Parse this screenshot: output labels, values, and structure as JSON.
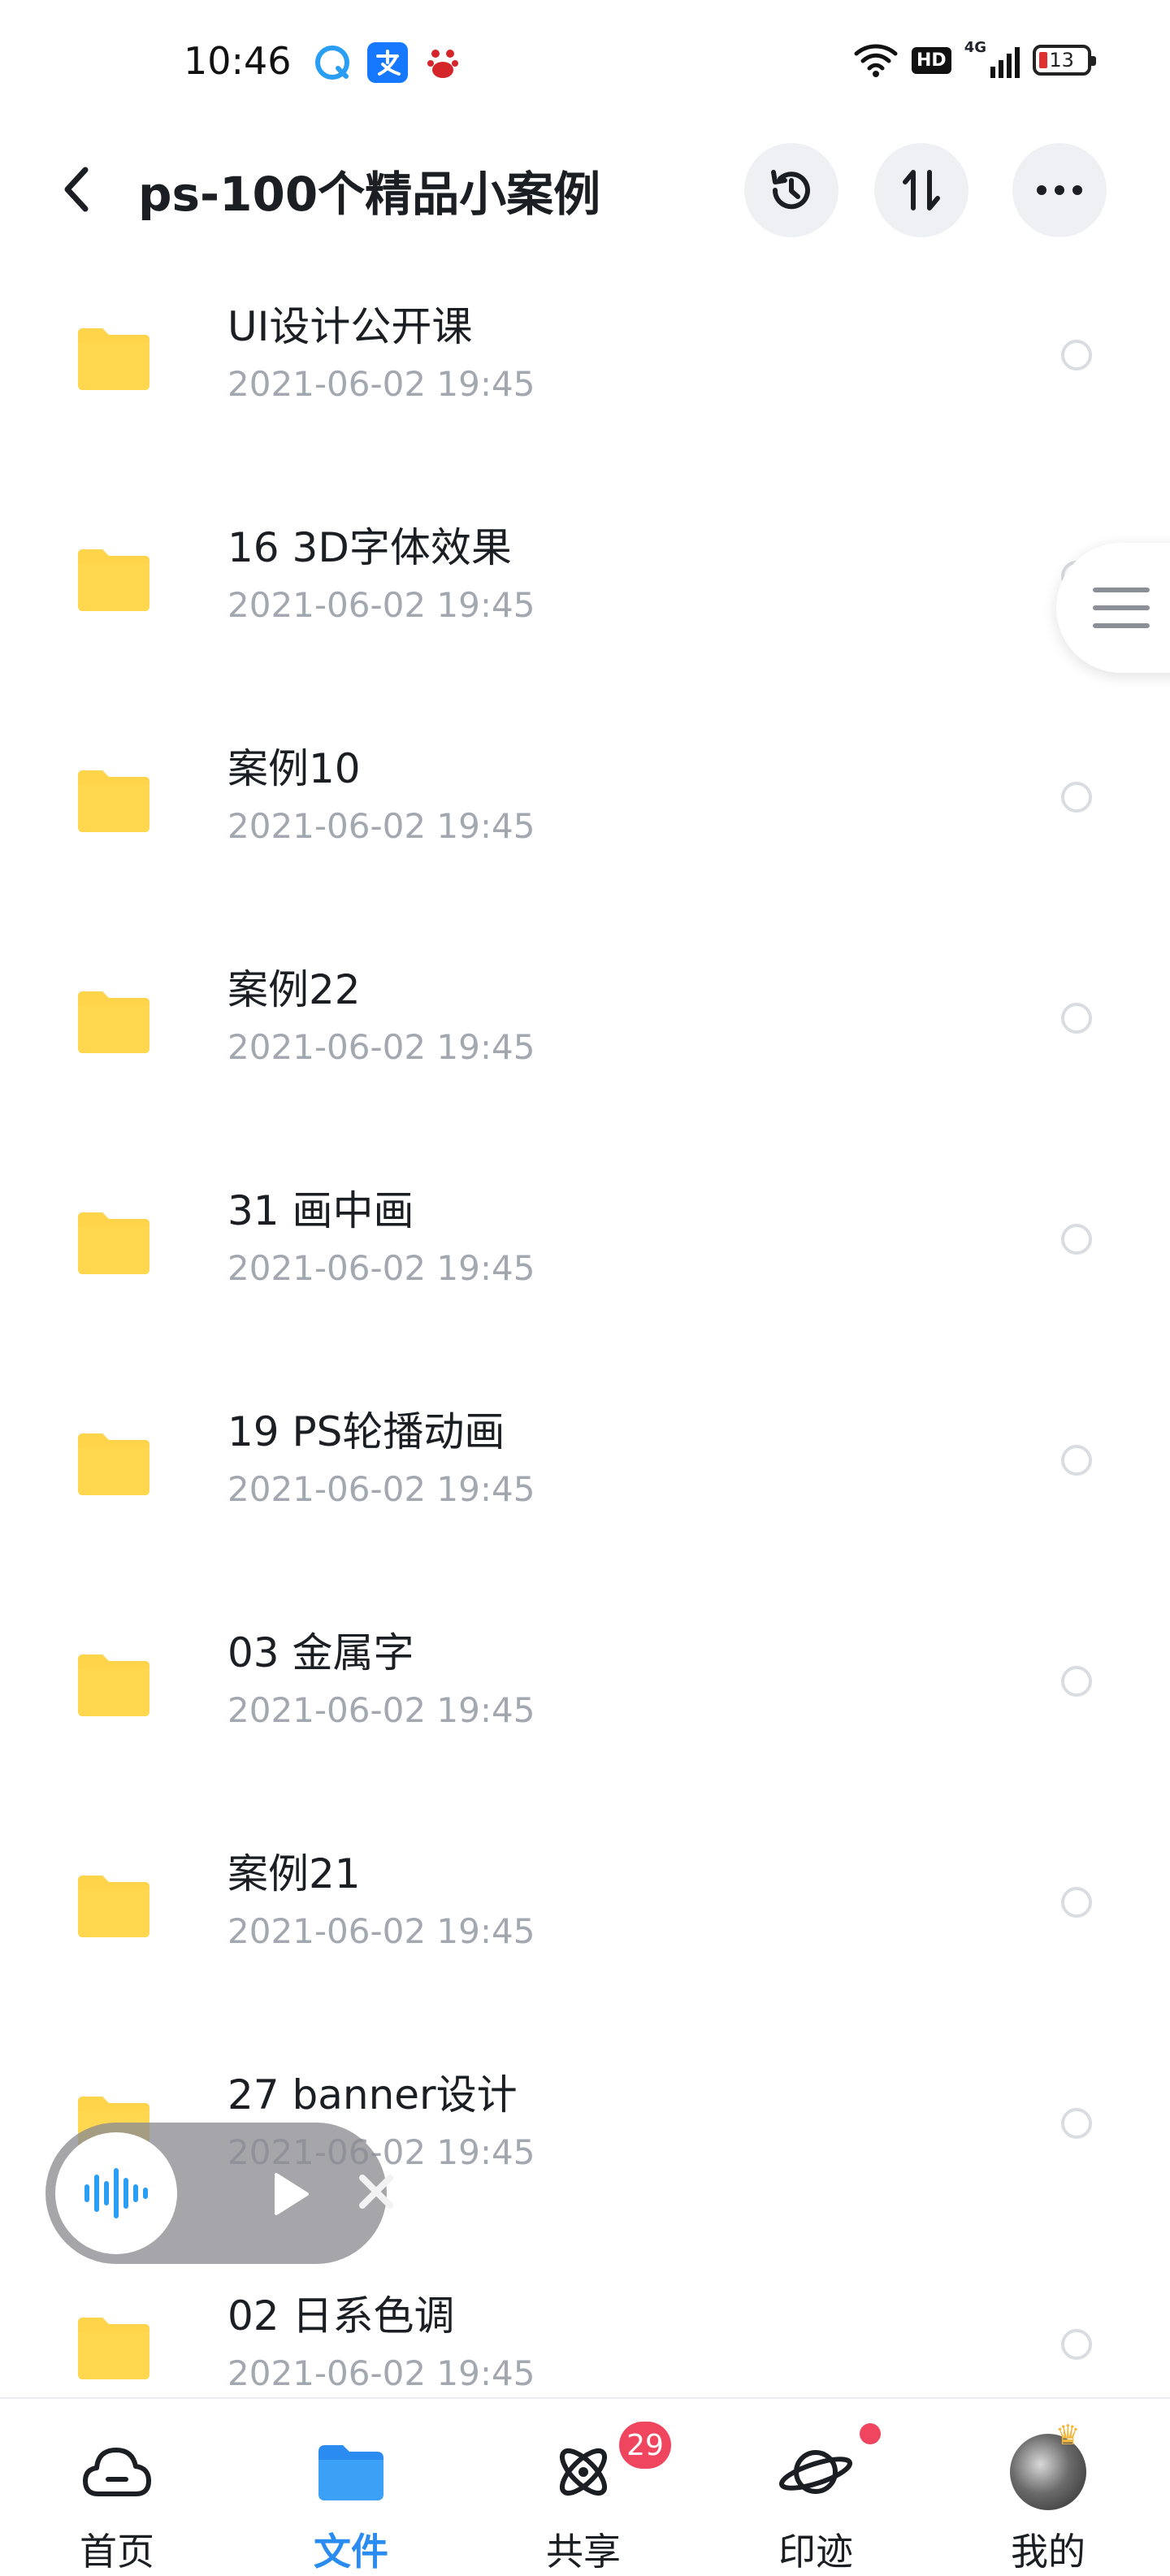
{
  "status_bar": {
    "time": "10:46",
    "app_icons": [
      "qq-browser-icon",
      "alipay-icon",
      "baidu-icon"
    ],
    "network": "4G",
    "hd": "HD",
    "battery": "13"
  },
  "header": {
    "title": "ps-100个精品小案例"
  },
  "files": [
    {
      "name": "UI设计公开课",
      "date": "2021-06-02  19:45"
    },
    {
      "name": "16 3D字体效果",
      "date": "2021-06-02  19:45"
    },
    {
      "name": "案例10",
      "date": "2021-06-02  19:45"
    },
    {
      "name": "案例22",
      "date": "2021-06-02  19:45"
    },
    {
      "name": "31 画中画",
      "date": "2021-06-02  19:45"
    },
    {
      "name": "19 PS轮播动画",
      "date": "2021-06-02  19:45"
    },
    {
      "name": "03 金属字",
      "date": "2021-06-02  19:45"
    },
    {
      "name": "案例21",
      "date": "2021-06-02  19:45"
    },
    {
      "name": "27 banner设计",
      "date": "2021-06-02  19:45"
    },
    {
      "name": "02 日系色调",
      "date": "2021-06-02  19:45"
    }
  ],
  "tabs": [
    {
      "label": "首页",
      "icon": "cloud-icon",
      "active": false
    },
    {
      "label": "文件",
      "icon": "folder-icon",
      "active": true
    },
    {
      "label": "共享",
      "icon": "orbit-icon",
      "active": false,
      "badge": "29"
    },
    {
      "label": "印迹",
      "icon": "planet-icon",
      "active": false,
      "dot": true
    },
    {
      "label": "我的",
      "icon": "avatar",
      "active": false
    }
  ],
  "colors": {
    "accent": "#2a8cf0",
    "folder": "#fdd44a",
    "badge": "#f0455e",
    "date_text": "#a3a8b0"
  }
}
